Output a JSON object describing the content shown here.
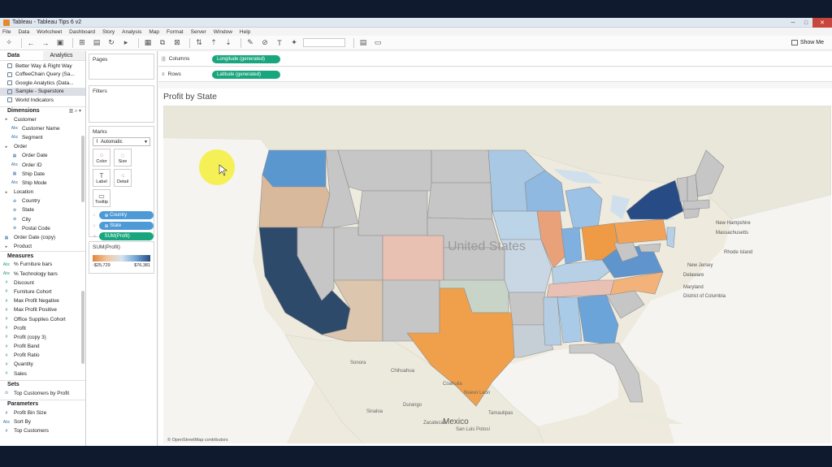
{
  "window": {
    "title": "Tableau - Tableau Tips 6 v2"
  },
  "menu": [
    "File",
    "Data",
    "Worksheet",
    "Dashboard",
    "Story",
    "Analysis",
    "Map",
    "Format",
    "Server",
    "Window",
    "Help"
  ],
  "toolbar": {
    "show_me_label": "Show Me"
  },
  "data_pane": {
    "tabs": [
      "Data",
      "Analytics"
    ],
    "data_sources": [
      {
        "label": "Better Way & Right Way",
        "active": false
      },
      {
        "label": "CoffeeChain Query (Sa...",
        "active": false
      },
      {
        "label": "Google Analytics (Data...",
        "active": false
      },
      {
        "label": "Sample - Superstore",
        "active": true
      },
      {
        "label": "World Indicators",
        "active": false
      }
    ],
    "dimensions_header": "Dimensions",
    "dimensions": [
      {
        "label": "Customer",
        "type": "folder",
        "icon": "▸"
      },
      {
        "label": "Customer Name",
        "type": "child",
        "icon": "Abc"
      },
      {
        "label": "Segment",
        "type": "child",
        "icon": "Abc"
      },
      {
        "label": "Order",
        "type": "folder",
        "icon": "▸"
      },
      {
        "label": "Order Date",
        "type": "child",
        "icon": "▦"
      },
      {
        "label": "Order ID",
        "type": "child",
        "icon": "Abc"
      },
      {
        "label": "Ship Date",
        "type": "child",
        "icon": "▦"
      },
      {
        "label": "Ship Mode",
        "type": "child",
        "icon": "Abc"
      },
      {
        "label": "Location",
        "type": "folder",
        "icon": "▸"
      },
      {
        "label": "Country",
        "type": "child",
        "icon": "⊕"
      },
      {
        "label": "State",
        "type": "child",
        "icon": "⊕"
      },
      {
        "label": "City",
        "type": "child",
        "icon": "⊕"
      },
      {
        "label": "Postal Code",
        "type": "child",
        "icon": "⊕"
      },
      {
        "label": "Order Date (copy)",
        "type": "top",
        "icon": "▦"
      },
      {
        "label": "Product",
        "type": "folder",
        "icon": "▸"
      }
    ],
    "measures_header": "Measures",
    "measures": [
      {
        "label": "% Furniture bars",
        "icon": "Abc"
      },
      {
        "label": "% Technology bars",
        "icon": "Abc"
      },
      {
        "label": "Discount",
        "icon": "#"
      },
      {
        "label": "Furniture Cohort",
        "icon": "#"
      },
      {
        "label": "Max Profit Negative",
        "icon": "#"
      },
      {
        "label": "Max Profit Positive",
        "icon": "#"
      },
      {
        "label": "Office Supplies Cohort",
        "icon": "#"
      },
      {
        "label": "Profit",
        "icon": "#"
      },
      {
        "label": "Profit (copy 3)",
        "icon": "#"
      },
      {
        "label": "Profit Band",
        "icon": "#"
      },
      {
        "label": "Profit Ratio",
        "icon": "#"
      },
      {
        "label": "Quantity",
        "icon": "#"
      },
      {
        "label": "Sales",
        "icon": "#"
      }
    ],
    "sets_header": "Sets",
    "sets": [
      {
        "label": "Top Customers by Profit",
        "icon": "⊙"
      }
    ],
    "parameters_header": "Parameters",
    "parameters": [
      {
        "label": "Profit Bin Size",
        "icon": "#"
      },
      {
        "label": "Sort By",
        "icon": "Abc"
      },
      {
        "label": "Top Customers",
        "icon": "#"
      }
    ]
  },
  "cards": {
    "pages_title": "Pages",
    "filters_title": "Filters",
    "marks_title": "Marks",
    "mark_type": "Automatic",
    "mark_buttons": [
      {
        "label": "Color",
        "icon": "color-icon"
      },
      {
        "label": "Size",
        "icon": "size-icon"
      },
      {
        "label": "Label",
        "icon": "label-icon"
      },
      {
        "label": "Detail",
        "icon": "detail-icon"
      },
      {
        "label": "Tooltip",
        "icon": "tooltip-icon"
      }
    ],
    "mark_pills": [
      {
        "label": "Country",
        "kind": "dimension",
        "color": "#4e9ad6"
      },
      {
        "label": "State",
        "kind": "dimension",
        "color": "#4e9ad6"
      },
      {
        "label": "SUM(Profit)",
        "kind": "measure",
        "color": "#19a67e"
      }
    ],
    "legend_title": "SUM(Profit)",
    "legend_min": "-$25,729",
    "legend_max": "$76,381",
    "legend_colors": {
      "low": "#e3843a",
      "mid": "#d7e3ee",
      "high": "#274b84"
    }
  },
  "shelves": {
    "columns_label": "Columns",
    "columns_pill": "Longitude (generated)",
    "rows_label": "Rows",
    "rows_pill": "Latitude (generated)",
    "pill_color": "#19a67e"
  },
  "viz": {
    "title": "Profit by State",
    "attribution": "© OpenStreetMap contributors",
    "map_labels": [
      "United States",
      "Mexico",
      "New Hampshire",
      "Massachusetts",
      "Rhode Island",
      "New Jersey",
      "Delaware",
      "Maryland",
      "District of Columbia",
      "Chihuahua",
      "Coahuila",
      "Sonora",
      "Durango",
      "Nuevo León",
      "Sinaloa",
      "Tamaulipas",
      "San Luis Potosí",
      "Zacatecas"
    ],
    "state_colors": {
      "Washington": "#5b97cf",
      "California": "#2d4a6b",
      "Texas": "#f0a04a",
      "New York": "#274b84",
      "Pennsylvania": "#f2a35a",
      "Ohio": "#ef9a45",
      "Illinois": "#e9a17a",
      "Oregon": "#d9b99c",
      "Colorado": "#e9c1b3",
      "Michigan": "#9cc2e6",
      "Wisconsin": "#8fb9e0",
      "Minnesota": "#a9c8e3",
      "Indiana": "#7fb0df",
      "Virginia": "#5f95cc",
      "Georgia": "#6aa4d9",
      "Kentucky": "#b7d0e6",
      "Tennessee": "#e8c0b4",
      "North Carolina": "#f3b27a",
      "Alabama": "#a9cbe8",
      "Arizona": "#dcc6ad",
      "Iowa": "#bcd4e8",
      "Mississippi": "#b4cde3",
      "Florida": "#c9c9c9",
      "Missouri": "#c9d7e4",
      "New Jersey": "#b7d0ea",
      "Oklahoma": "#c9d4c9",
      "Louisiana": "#c6cfd6"
    }
  }
}
